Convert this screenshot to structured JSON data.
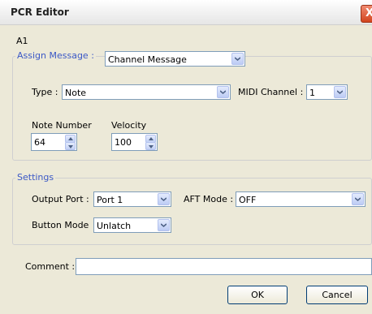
{
  "window": {
    "title": "PCR Editor",
    "close_glyph": "X"
  },
  "item_name": "A1",
  "assign": {
    "label": "Assign Message :",
    "value": "Channel Message",
    "type_label": "Type :",
    "type_value": "Note",
    "midi_channel_label": "MIDI Channel :",
    "midi_channel_value": "1",
    "note_number_label": "Note Number",
    "note_number_value": "64",
    "velocity_label": "Velocity",
    "velocity_value": "100"
  },
  "settings": {
    "legend": "Settings",
    "output_port_label": "Output Port :",
    "output_port_value": "Port 1",
    "aft_mode_label": "AFT Mode :",
    "aft_mode_value": "OFF",
    "button_mode_label": "Button Mode",
    "button_mode_value": "Unlatch"
  },
  "comment": {
    "label": "Comment :",
    "value": ""
  },
  "buttons": {
    "ok": "OK",
    "cancel": "Cancel"
  },
  "colors": {
    "legend": "#3b58c6",
    "face": "#ece9d8",
    "field_border": "#7f9db9",
    "close": "#d2441e"
  },
  "icons": {
    "dropdown": "chevron-down-icon",
    "spin_up": "spin-up-icon",
    "spin_down": "spin-down-icon",
    "close": "close-icon"
  }
}
